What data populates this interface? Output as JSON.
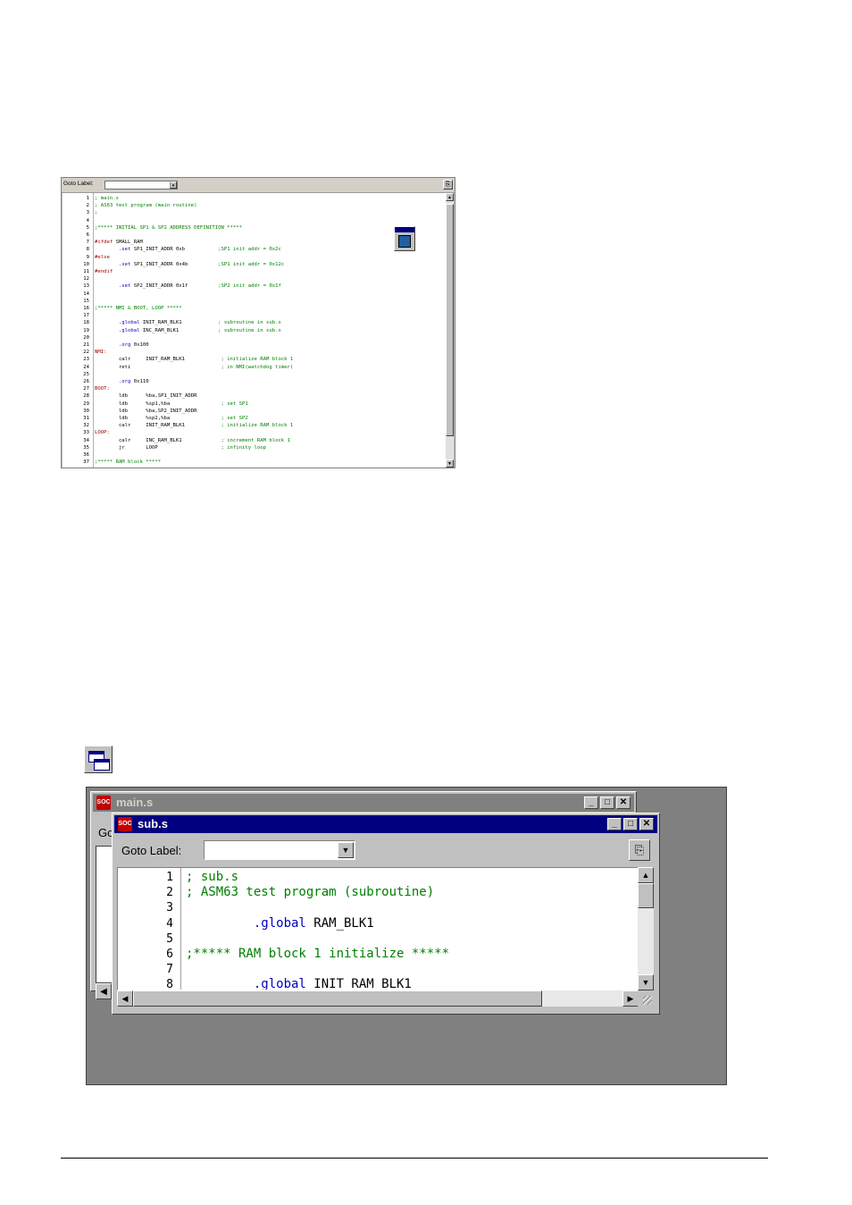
{
  "editor_small": {
    "goto_label": "Goto Label:",
    "combo_arrow": "▾",
    "toolbar_icon": "copy-icon",
    "lines": [
      {
        "n": "1",
        "segs": [
          {
            "t": "; main.s",
            "c": "g"
          }
        ]
      },
      {
        "n": "2",
        "segs": [
          {
            "t": "; AS63 test program (main routine)",
            "c": "g"
          }
        ]
      },
      {
        "n": "3",
        "segs": [
          {
            "t": ";",
            "c": "g"
          }
        ]
      },
      {
        "n": "4",
        "segs": []
      },
      {
        "n": "5",
        "segs": [
          {
            "t": ";***** INITIAL SP1 & SP2 ADDRESS DEFINITION *****",
            "c": "g"
          }
        ]
      },
      {
        "n": "6",
        "segs": []
      },
      {
        "n": "7",
        "segs": [
          {
            "t": "#ifdef",
            "c": "r"
          },
          {
            "t": " SMALL_RAM",
            "c": "k"
          }
        ]
      },
      {
        "n": "8",
        "segs": [
          {
            "t": "        .set",
            "c": "b"
          },
          {
            "t": " SP1_INIT_ADDR 0xb           ",
            "c": "k"
          },
          {
            "t": ";SP1 init addr = 0x2c",
            "c": "g"
          }
        ]
      },
      {
        "n": "9",
        "segs": [
          {
            "t": "#else",
            "c": "r"
          }
        ]
      },
      {
        "n": "10",
        "segs": [
          {
            "t": "        .set",
            "c": "b"
          },
          {
            "t": " SP1_INIT_ADDR 0x4b          ",
            "c": "k"
          },
          {
            "t": ";SP1 init addr = 0x12c",
            "c": "g"
          }
        ]
      },
      {
        "n": "11",
        "segs": [
          {
            "t": "#endif",
            "c": "r"
          }
        ]
      },
      {
        "n": "12",
        "segs": []
      },
      {
        "n": "13",
        "segs": [
          {
            "t": "        .set",
            "c": "b"
          },
          {
            "t": " SP2_INIT_ADDR 0x1f          ",
            "c": "k"
          },
          {
            "t": ";SP2 init addr = 0x1f",
            "c": "g"
          }
        ]
      },
      {
        "n": "14",
        "segs": []
      },
      {
        "n": "15",
        "segs": []
      },
      {
        "n": "16",
        "segs": [
          {
            "t": ";***** NMI & BOOT, LOOP *****",
            "c": "g"
          }
        ]
      },
      {
        "n": "17",
        "segs": []
      },
      {
        "n": "18",
        "segs": [
          {
            "t": "        .global",
            "c": "b"
          },
          {
            "t": " INIT_RAM_BLK1            ",
            "c": "k"
          },
          {
            "t": "; subroutine in sub.s",
            "c": "g"
          }
        ]
      },
      {
        "n": "19",
        "segs": [
          {
            "t": "        .global",
            "c": "b"
          },
          {
            "t": " INC_RAM_BLK1             ",
            "c": "k"
          },
          {
            "t": "; subroutine in sub.s",
            "c": "g"
          }
        ]
      },
      {
        "n": "20",
        "segs": []
      },
      {
        "n": "21",
        "segs": [
          {
            "t": "        .org",
            "c": "b"
          },
          {
            "t": " 0x100",
            "c": "k"
          }
        ]
      },
      {
        "n": "22",
        "segs": [
          {
            "t": "NMI:",
            "c": "r"
          }
        ]
      },
      {
        "n": "23",
        "segs": [
          {
            "t": "        calr     INIT_RAM_BLK1            ",
            "c": "k"
          },
          {
            "t": "; initialize RAM block 1",
            "c": "g"
          }
        ]
      },
      {
        "n": "24",
        "segs": [
          {
            "t": "        reti                              ",
            "c": "k"
          },
          {
            "t": "; in NMI(watchdog timer)",
            "c": "g"
          }
        ]
      },
      {
        "n": "25",
        "segs": []
      },
      {
        "n": "26",
        "segs": [
          {
            "t": "        .org",
            "c": "b"
          },
          {
            "t": " 0x110",
            "c": "k"
          }
        ]
      },
      {
        "n": "27",
        "segs": [
          {
            "t": "BOOT:",
            "c": "r"
          }
        ]
      },
      {
        "n": "28",
        "segs": [
          {
            "t": "        ldb      %ba,SP1_INIT_ADDR",
            "c": "k"
          }
        ]
      },
      {
        "n": "29",
        "segs": [
          {
            "t": "        ldb      %sp1,%ba                 ",
            "c": "k"
          },
          {
            "t": "; set SP1",
            "c": "g"
          }
        ]
      },
      {
        "n": "30",
        "segs": [
          {
            "t": "        ldb      %ba,SP2_INIT_ADDR",
            "c": "k"
          }
        ]
      },
      {
        "n": "31",
        "segs": [
          {
            "t": "        ldb      %sp2,%ba                 ",
            "c": "k"
          },
          {
            "t": "; set SP2",
            "c": "g"
          }
        ]
      },
      {
        "n": "32",
        "segs": [
          {
            "t": "        calr     INIT_RAM_BLK1            ",
            "c": "k"
          },
          {
            "t": "; initialize RAM block 1",
            "c": "g"
          }
        ]
      },
      {
        "n": "33",
        "segs": [
          {
            "t": "LOOP:",
            "c": "r"
          }
        ]
      },
      {
        "n": "34",
        "segs": [
          {
            "t": "        calr     INC_RAM_BLK1             ",
            "c": "k"
          },
          {
            "t": "; increment RAM block 1",
            "c": "g"
          }
        ]
      },
      {
        "n": "35",
        "segs": [
          {
            "t": "        jr       LOOP                     ",
            "c": "k"
          },
          {
            "t": "; infinity loop",
            "c": "g"
          }
        ]
      },
      {
        "n": "36",
        "segs": []
      },
      {
        "n": "37",
        "segs": [
          {
            "t": ";***** RAM block *****",
            "c": "g"
          }
        ]
      }
    ]
  },
  "scroll": {
    "up": "▲",
    "down": "▼",
    "left": "◀",
    "right": "▶"
  },
  "mdi": {
    "main_window": {
      "title": "main.s",
      "goto_fragment": "Go",
      "icon_text": "SOC",
      "buttons": {
        "minimize": "_",
        "maximize": "□",
        "close": "✕"
      }
    },
    "sub_window": {
      "title": "sub.s",
      "icon_text": "SOC",
      "goto_label": "Goto Label:",
      "combo_arrow": "▼",
      "toolbar_icon_glyph": "⎘",
      "buttons": {
        "minimize": "_",
        "maximize": "□",
        "close": "✕"
      },
      "lines": [
        {
          "n": "1",
          "segs": [
            {
              "t": "; sub.s",
              "c": "g"
            }
          ]
        },
        {
          "n": "2",
          "segs": [
            {
              "t": "; ASM63 test program (subroutine)",
              "c": "g"
            }
          ]
        },
        {
          "n": "3",
          "segs": []
        },
        {
          "n": "4",
          "segs": [
            {
              "t": "         .global",
              "c": "b"
            },
            {
              "t": " RAM_BLK1",
              "c": "k"
            }
          ]
        },
        {
          "n": "5",
          "segs": []
        },
        {
          "n": "6",
          "segs": [
            {
              "t": ";***** RAM block 1 initialize *****",
              "c": "g"
            }
          ]
        },
        {
          "n": "7",
          "segs": []
        },
        {
          "n": "8",
          "segs": [
            {
              "t": "         .global",
              "c": "b"
            },
            {
              "t": " INIT RAM BLK1",
              "c": "k"
            }
          ]
        }
      ]
    }
  },
  "colors": {
    "active_title": "#000080",
    "inactive_title": "#808080",
    "comment": "#008000",
    "directive": "#0000c0",
    "label": "#a00000"
  }
}
